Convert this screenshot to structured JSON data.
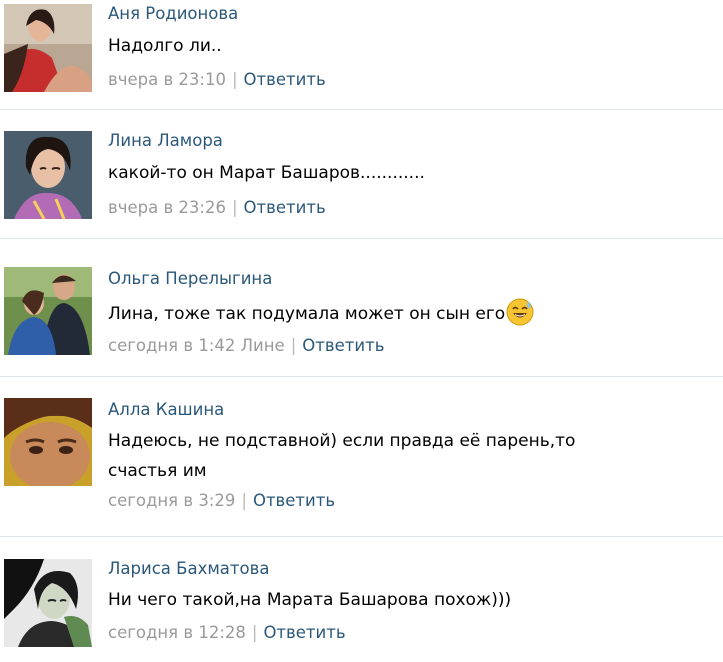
{
  "comments": [
    {
      "author": "Аня Родионова",
      "text": [
        "Надолго ли.."
      ],
      "time": "вчера в 23:10",
      "reply_to": "",
      "reply_label": "Ответить",
      "avatar_icon": "user-photo"
    },
    {
      "author": "Лина Ламора",
      "text": [
        "какой-то он Марат Башаров............"
      ],
      "time": "вчера в 23:26",
      "reply_to": "",
      "reply_label": "Ответить",
      "avatar_icon": "user-photo"
    },
    {
      "author": "Ольга Перелыгина",
      "text": [
        "Лина, тоже так подумала может он сын его"
      ],
      "emoji": "sweat-smile-emoji",
      "time": "сегодня в 1:42",
      "reply_to": "Лине",
      "reply_label": "Ответить",
      "avatar_icon": "user-photo"
    },
    {
      "author": "Алла Кашина",
      "text": [
        "Надеюсь, не подставной) если правда её парень,то",
        "счастья им"
      ],
      "time": "сегодня в 3:29",
      "reply_to": "",
      "reply_label": "Ответить",
      "avatar_icon": "user-photo"
    },
    {
      "author": "Лариса Бахматова",
      "text": [
        "Ни чего такой,на Марата Башарова похож)))"
      ],
      "time": "сегодня в 12:28",
      "reply_to": "",
      "reply_label": "Ответить",
      "avatar_icon": "user-photo"
    }
  ],
  "colors": {
    "author_link": "#2b587a",
    "meta_text": "#9a9a9a",
    "divider": "#dfe4ea",
    "background": "#ffffff"
  }
}
